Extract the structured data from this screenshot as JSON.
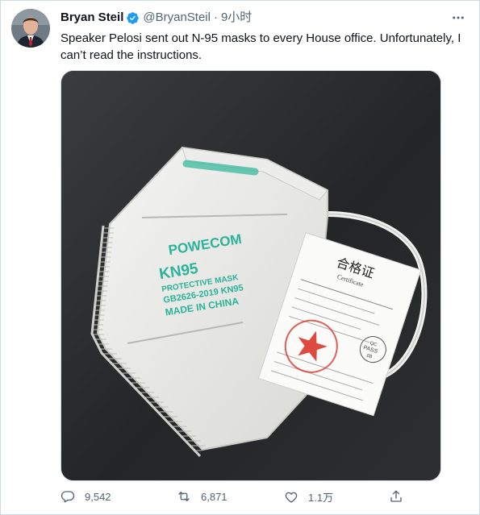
{
  "tweet": {
    "author_name": "Bryan Steil",
    "handle": "@BryanSteil",
    "separator": "·",
    "time": "9小时",
    "text": "Speaker Pelosi sent out N-95 masks to every House office. Unfortunately, I can’t read the instructions.",
    "verified": true
  },
  "media": {
    "mask_brand": "POWECOM",
    "mask_line1": "KN95",
    "mask_line2": "PROTECTIVE MASK",
    "mask_line3": "GB2626-2019 KN95",
    "mask_line4": "MADE IN CHINA",
    "tag_title": "合格证",
    "tag_subtitle": "Certificate",
    "qc_line1": "QC",
    "qc_line2": "PASS",
    "qc_line3": "08"
  },
  "actions": {
    "replies": "9,542",
    "retweets": "6,871",
    "likes": "1.1万"
  },
  "colors": {
    "verified_blue": "#1d9bf0",
    "secondary_text": "#536471",
    "mask_print": "#2bb39a",
    "stamp_red": "#d9362b"
  },
  "icons": [
    "verified-badge-icon",
    "more-options-icon",
    "reply-icon",
    "retweet-icon",
    "like-icon",
    "share-icon"
  ]
}
